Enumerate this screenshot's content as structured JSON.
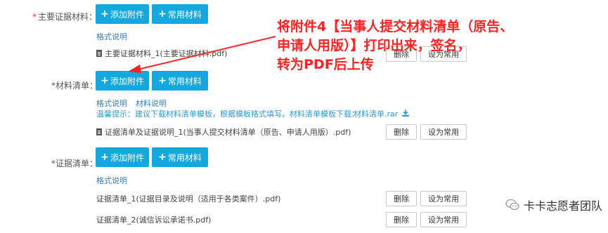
{
  "main_materials": {
    "label": "主要证据材料：",
    "add_button": "添加附件",
    "common_button": "常用材料",
    "format_link": "格式说明",
    "file_name": "主要证据材料_1(主要证据材料.pdf)",
    "delete_label": "删除",
    "set_common_label": "设为常用"
  },
  "material_list": {
    "label": "*材料清单：",
    "add_button": "添加附件",
    "common_button": "常用材料",
    "format_link": "格式说明",
    "material_link": "材料说明",
    "tip_text": "温馨提示：建议下载材料清单模板，根据模板格式填写。材料清单模板下载：",
    "template_link": "材料清单.rar",
    "file_name": "证据清单及证据说明_1(当事人提交材料清单（原告、申请人用版）.pdf)",
    "delete_label": "删除",
    "set_common_label": "设为常用"
  },
  "evidence_list": {
    "label": "*证据清单：",
    "add_button": "添加附件",
    "common_button": "常用材料",
    "format_link": "格式说明",
    "files": [
      {
        "name": "证据清单_1(证据目录及说明（适用于各类案件）.pdf)",
        "delete_label": "删除",
        "set_common_label": "设为常用"
      },
      {
        "name": "证据清单_2(诚信诉讼承诺书.pdf)",
        "delete_label": "删除",
        "set_common_label": "设为常用"
      }
    ]
  },
  "annotation": {
    "line1": "将附件4【当事人提交材料清单（原告、",
    "line2": "申请人用版）】打印出来，签名，",
    "line3": "转为PDF后上传",
    "color": "#ff2222"
  },
  "watermark": {
    "text": "卡卡志愿者团队",
    "icon": "wechat-icon"
  },
  "colors": {
    "primary_button": "#13a8e0",
    "link": "#2f7fc0",
    "required": "#e4393c"
  }
}
